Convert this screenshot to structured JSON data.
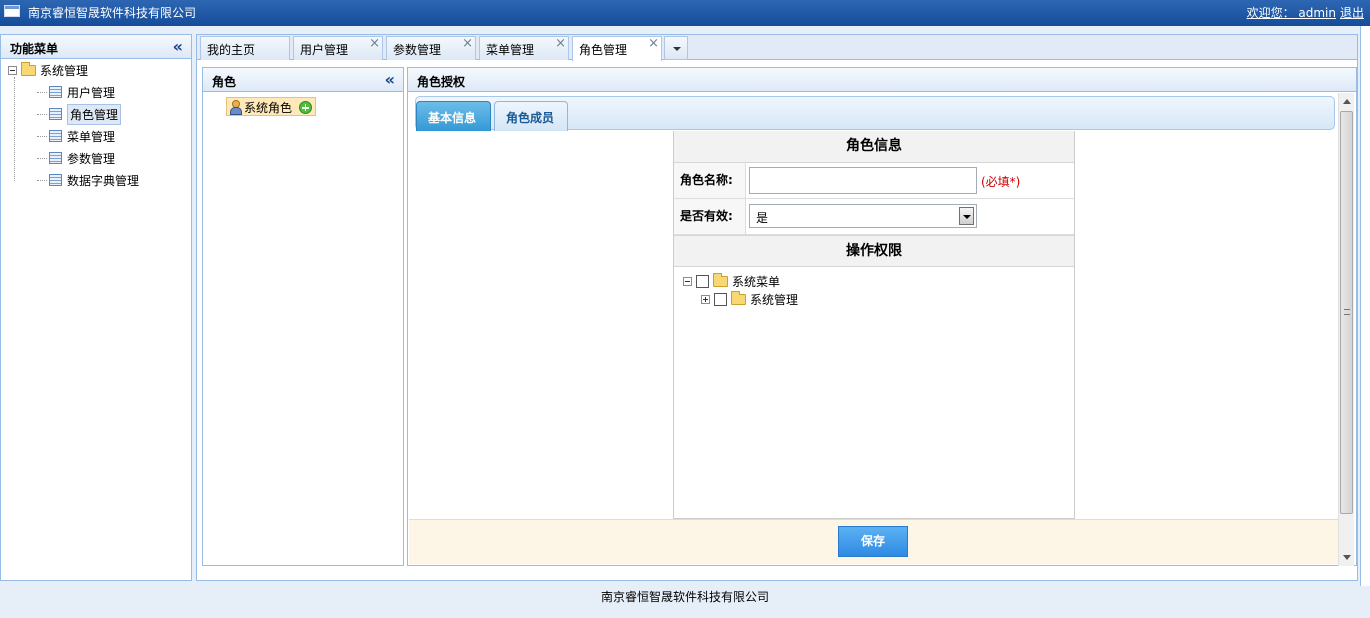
{
  "header": {
    "title": "南京睿恒智晟软件科技有限公司",
    "welcome": "欢迎您：  admin",
    "logout": "退出"
  },
  "sidebar": {
    "title": "功能菜单",
    "collapse": "«",
    "root": "系统管理",
    "items": [
      {
        "label": "用户管理"
      },
      {
        "label": "角色管理"
      },
      {
        "label": "菜单管理"
      },
      {
        "label": "参数管理"
      },
      {
        "label": "数据字典管理"
      }
    ]
  },
  "tabs": [
    {
      "label": "我的主页",
      "closable": false
    },
    {
      "label": "用户管理",
      "closable": true
    },
    {
      "label": "参数管理",
      "closable": true
    },
    {
      "label": "菜单管理",
      "closable": true
    },
    {
      "label": "角色管理",
      "closable": true,
      "active": true
    }
  ],
  "tab_close_glyph": "×",
  "role_panel": {
    "title": "角色",
    "collapse": "«",
    "node": "系统角色"
  },
  "auth_panel": {
    "title": "角色授权",
    "tabs": [
      {
        "label": "基本信息",
        "active": true
      },
      {
        "label": "角色成员",
        "active": false
      }
    ],
    "role_info_title": "角色信息",
    "name_label": "角色名称:",
    "name_value": "",
    "required": "(必填*)",
    "valid_label": "是否有效:",
    "valid_value": "是",
    "perm_title": "操作权限",
    "perm_tree": {
      "root": "系统菜单",
      "child": "系统管理"
    },
    "save": "保存"
  },
  "footer": "南京睿恒智晟软件科技有限公司",
  "colors": {
    "header": "#1f5aa8",
    "accent": "#3399d6",
    "required": "#cc0000"
  }
}
